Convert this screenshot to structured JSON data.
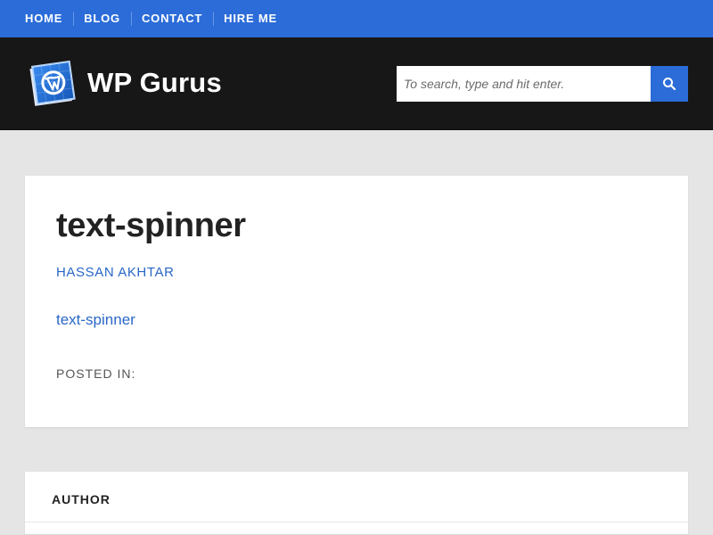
{
  "top_nav": {
    "items": [
      {
        "label": "HOME"
      },
      {
        "label": "BLOG"
      },
      {
        "label": "CONTACT"
      },
      {
        "label": "HIRE ME"
      }
    ]
  },
  "header": {
    "site_title": "WP Gurus",
    "search": {
      "placeholder": "To search, type and hit enter.",
      "value": ""
    }
  },
  "post": {
    "title": "text-spinner",
    "author": "HASSAN AKHTAR",
    "link_text": "text-spinner",
    "posted_in_label": "POSTED IN:"
  },
  "author_box": {
    "heading": "AUTHOR"
  },
  "colors": {
    "nav_blue": "#2b6cd8",
    "header_black": "#171717",
    "page_bg": "#e5e5e5",
    "card_bg": "#ffffff",
    "link_blue": "#2a67c8"
  },
  "icons": {
    "logo": "wordpress-logo-icon",
    "search": "search-icon"
  }
}
